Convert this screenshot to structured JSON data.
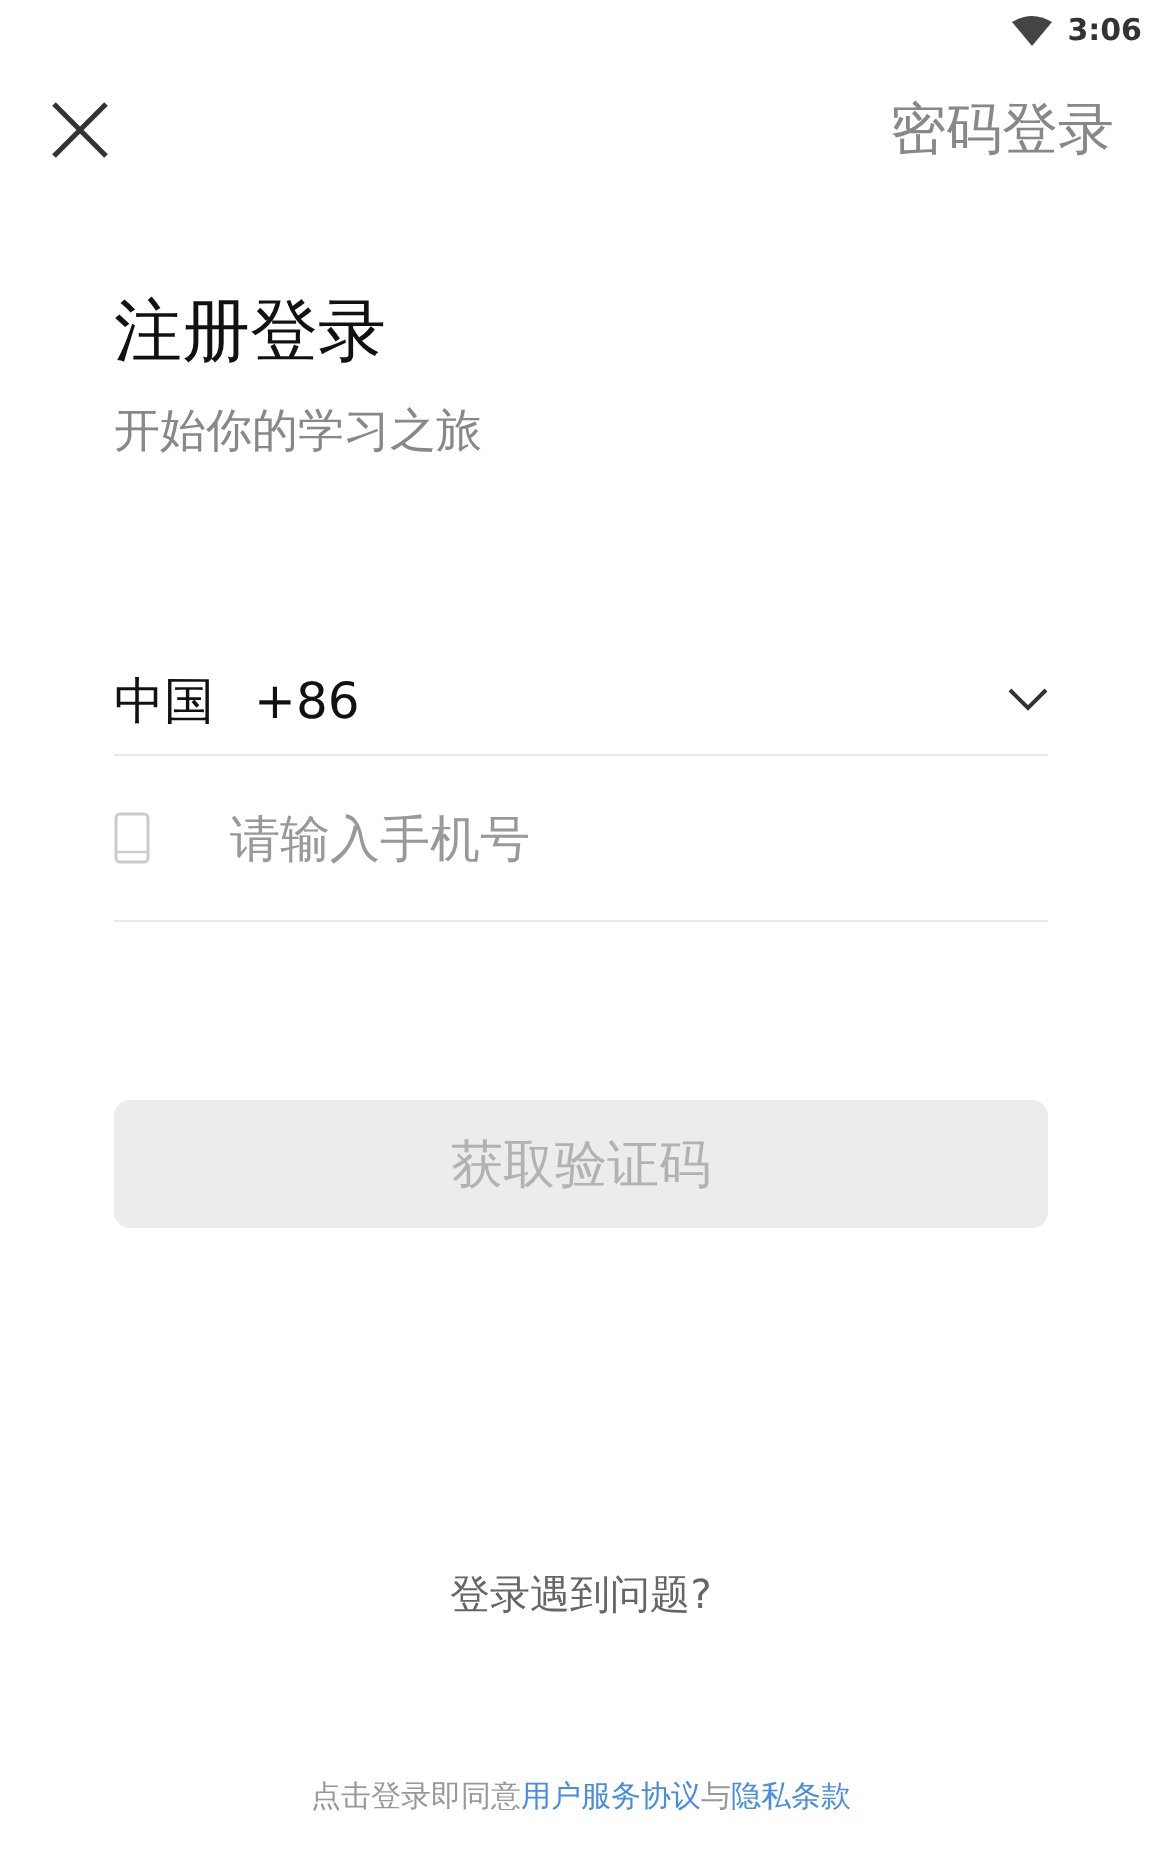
{
  "status_bar": {
    "time": "3:06"
  },
  "header": {
    "switch_link": "密码登录"
  },
  "title": "注册登录",
  "subtitle": "开始你的学习之旅",
  "country": {
    "name": "中国",
    "code": "+86"
  },
  "phone_field": {
    "placeholder": "请输入手机号"
  },
  "submit_button": {
    "label": "获取验证码",
    "disabled": true
  },
  "help_link": "登录遇到问题?",
  "agreement": [
    {
      "kind": "text",
      "text": "点击登录即同意"
    },
    {
      "kind": "link",
      "text": "用户服务协议"
    },
    {
      "kind": "text",
      "text": "与"
    },
    {
      "kind": "link",
      "text": "隐私条款"
    }
  ]
}
